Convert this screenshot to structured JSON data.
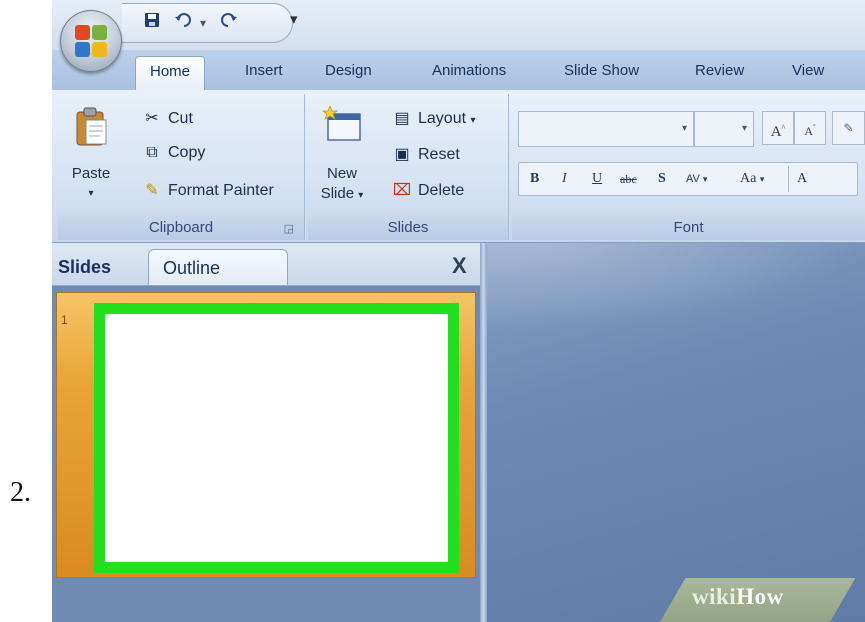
{
  "step_label": "2.",
  "quick_access": {
    "save_icon": "floppy-disk-icon",
    "undo_icon": "undo-icon",
    "redo_icon": "redo-icon"
  },
  "tabs": [
    {
      "label": "Home",
      "active": true
    },
    {
      "label": "Insert",
      "active": false
    },
    {
      "label": "Design",
      "active": false
    },
    {
      "label": "Animations",
      "active": false
    },
    {
      "label": "Slide Show",
      "active": false
    },
    {
      "label": "Review",
      "active": false
    },
    {
      "label": "View",
      "active": false
    }
  ],
  "ribbon": {
    "clipboard": {
      "paste": "Paste",
      "cut": "Cut",
      "copy": "Copy",
      "format_painter": "Format Painter",
      "group_label": "Clipboard"
    },
    "slides": {
      "new_slide_line1": "New",
      "new_slide_line2": "Slide",
      "layout": "Layout",
      "reset": "Reset",
      "delete": "Delete",
      "group_label": "Slides"
    },
    "font": {
      "grow": "A",
      "shrink": "A",
      "bold": "B",
      "italic": "I",
      "underline": "U",
      "strikethrough": "abc",
      "shadow": "S",
      "spacing": "AV",
      "change_case": "Aa",
      "font_color": "A",
      "group_label": "Font"
    }
  },
  "pane": {
    "tab_slides": "Slides",
    "tab_outline": "Outline",
    "close": "X",
    "slide_number": "1"
  },
  "colors": {
    "slide_border": "#22e01d",
    "selection": "#e9a63b"
  },
  "watermark": {
    "wiki": "wiki",
    "how": "How"
  }
}
